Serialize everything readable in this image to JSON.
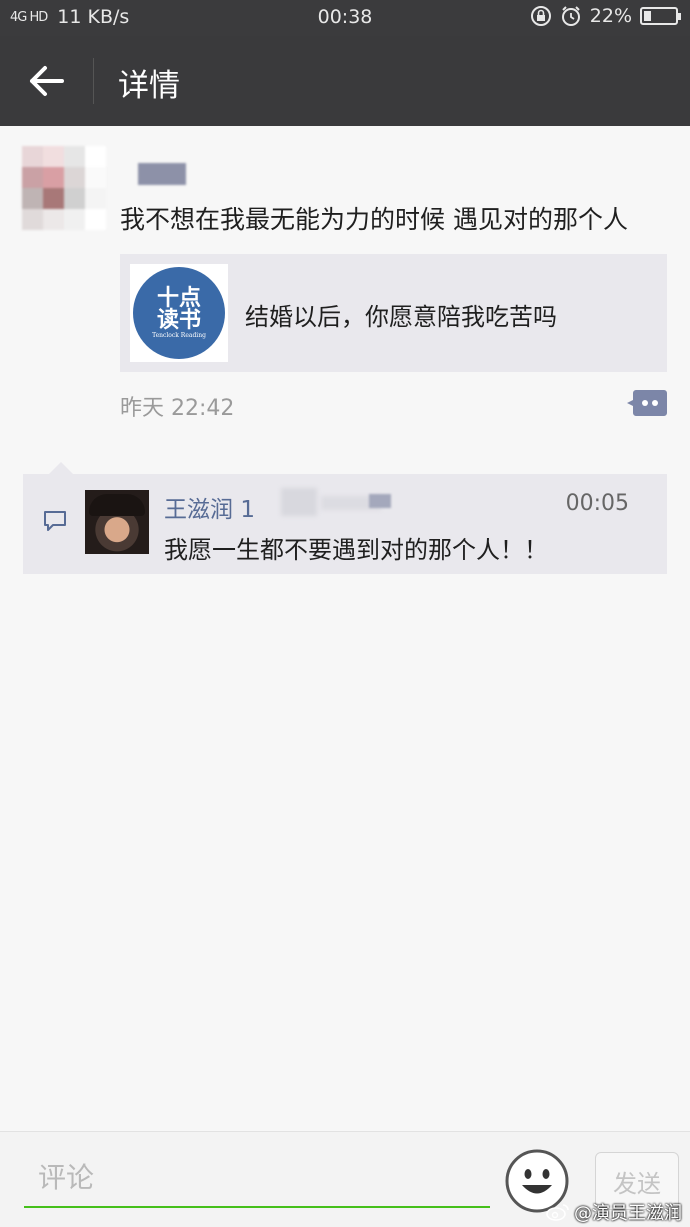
{
  "status_bar": {
    "signal": "4G HD",
    "net_speed": "11 KB/s",
    "time": "00:38",
    "battery": "22%",
    "battery_level": 0.22
  },
  "header": {
    "title": "详情"
  },
  "post": {
    "text": "我不想在我最无能为力的时候 遇见对的那个人",
    "link_card": {
      "title": "结婚以后，你愿意陪我吃苦吗",
      "logo_line1": "十点",
      "logo_line2": "读书",
      "logo_sub": "Tenclock Reading"
    },
    "time": "昨天 22:42"
  },
  "comment": {
    "user": "王滋润",
    "user_suffix": "1",
    "time": "00:05",
    "text": "我愿一生都不要遇到对的那个人！！"
  },
  "input_bar": {
    "placeholder": "评论",
    "send_label": "发送"
  },
  "watermark": {
    "text": "@演员王滋润"
  },
  "colors": {
    "accent": "#45c01a",
    "link_name": "#576b95",
    "header_bg": "#3a3a3c"
  }
}
